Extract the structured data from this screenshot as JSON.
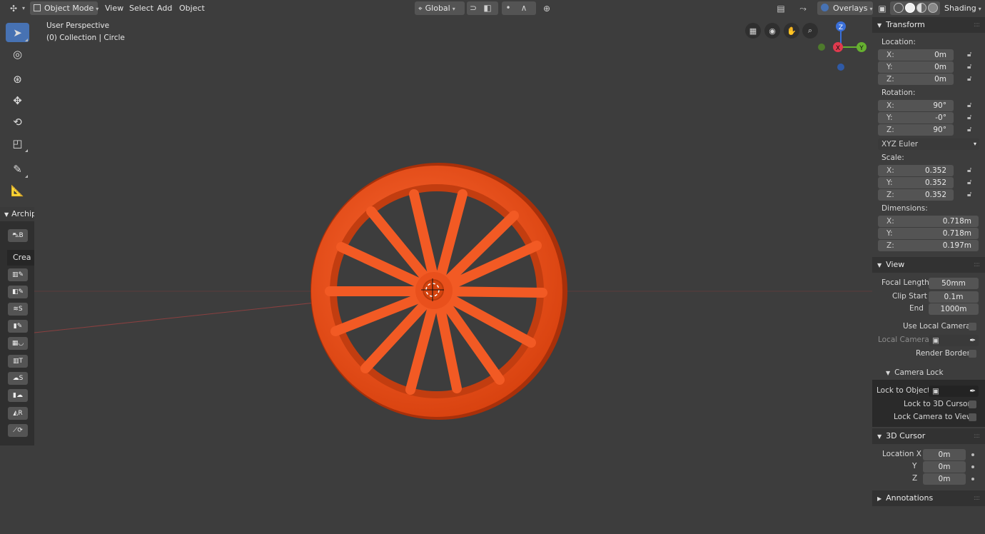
{
  "header": {
    "mode": "Object Mode",
    "menus": [
      "View",
      "Select",
      "Add",
      "Object"
    ],
    "orientation": "Global",
    "overlays": "Overlays",
    "shading": "Shading"
  },
  "viewport": {
    "perspective": "User Perspective",
    "collection": "(0) Collection | Circle",
    "object_color": "#e84c1c"
  },
  "archipack": {
    "title": "Archip",
    "create_label": "Crea",
    "buttons": [
      "B",
      "",
      "S",
      "",
      "",
      "T",
      "S",
      "",
      "R",
      ""
    ]
  },
  "gizmo": {
    "z": "Z",
    "y": "Y",
    "x": "X"
  },
  "transform": {
    "title": "Transform",
    "location_label": "Location:",
    "location": [
      {
        "k": "X:",
        "v": "0m"
      },
      {
        "k": "Y:",
        "v": "0m"
      },
      {
        "k": "Z:",
        "v": "0m"
      }
    ],
    "rotation_label": "Rotation:",
    "rotation": [
      {
        "k": "X:",
        "v": "90°"
      },
      {
        "k": "Y:",
        "v": "-0°"
      },
      {
        "k": "Z:",
        "v": "90°"
      }
    ],
    "rotation_mode": "XYZ Euler",
    "scale_label": "Scale:",
    "scale": [
      {
        "k": "X:",
        "v": "0.352"
      },
      {
        "k": "Y:",
        "v": "0.352"
      },
      {
        "k": "Z:",
        "v": "0.352"
      }
    ],
    "dimensions_label": "Dimensions:",
    "dimensions": [
      {
        "k": "X:",
        "v": "0.718m"
      },
      {
        "k": "Y:",
        "v": "0.718m"
      },
      {
        "k": "Z:",
        "v": "0.197m"
      }
    ]
  },
  "view": {
    "title": "View",
    "focal_length_label": "Focal Length",
    "focal_length": "50mm",
    "clip_start_label": "Clip Start",
    "clip_start": "0.1m",
    "clip_end_label": "End",
    "clip_end": "1000m",
    "use_local_camera": "Use Local Camera",
    "local_camera": "Local Camera",
    "render_border": "Render Border",
    "camera_lock": "Camera Lock",
    "lock_to_object": "Lock to Object",
    "lock_to_cursor": "Lock to 3D Cursor",
    "lock_camera_to_view": "Lock Camera to View"
  },
  "cursor": {
    "title": "3D Cursor",
    "location_x_label": "Location X",
    "y_label": "Y",
    "z_label": "Z",
    "x": "0m",
    "y": "0m",
    "z": "0m"
  },
  "annotations": {
    "title": "Annotations"
  }
}
